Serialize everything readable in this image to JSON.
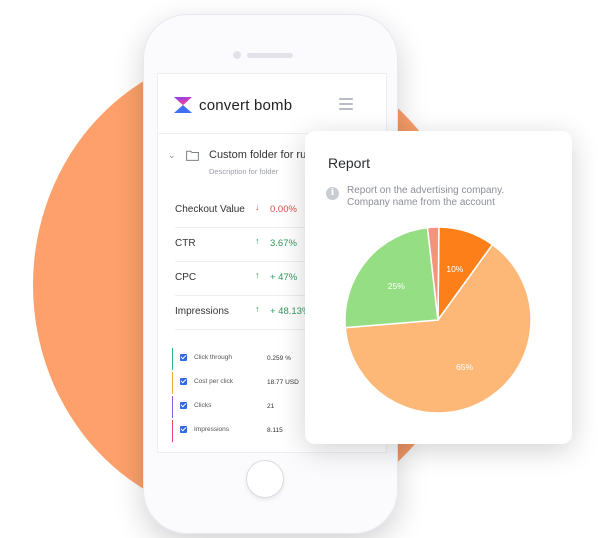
{
  "app": {
    "logo_text": "convert bomb"
  },
  "folder": {
    "title": "Custom folder for rules",
    "description": "Description for folder"
  },
  "metrics": [
    {
      "label": "Checkout Value",
      "direction": "down",
      "value": "0.00%",
      "color": "#e04a4a"
    },
    {
      "label": "CTR",
      "direction": "up",
      "value": "3.67%",
      "color": "#2e9a5e"
    },
    {
      "label": "CPC",
      "direction": "up",
      "value": "+ 47%",
      "color": "#2e9a5e"
    },
    {
      "label": "Impressions",
      "direction": "up",
      "value": "+ 48.13%",
      "color": "#2e9a5e"
    }
  ],
  "mini_table": [
    {
      "name": "Click through",
      "value": "0.259 %",
      "color": "#35b384",
      "checked": true
    },
    {
      "name": "Cost per click",
      "value": "18.77 USD",
      "color": "#f4a640",
      "checked": true
    },
    {
      "name": "Clicks",
      "value": "21",
      "color": "#8a5cd6",
      "checked": true
    },
    {
      "name": "Impressions",
      "value": "8.115",
      "color": "#e0476b",
      "checked": true
    }
  ],
  "report": {
    "title": "Report",
    "description_line1": "Report on the advertising company.",
    "description_line2": "Company name from the account"
  },
  "chart_data": {
    "type": "pie",
    "slices": [
      {
        "value": 65,
        "label": "65%",
        "color": "#fdb777"
      },
      {
        "value": 25,
        "label": "25%",
        "color": "#95de84"
      },
      {
        "value": 2,
        "label": "",
        "color": "#f59380"
      },
      {
        "value": 10,
        "label": "10%",
        "color": "#fd7f1a"
      }
    ]
  },
  "colors": {
    "accent_orange": "#fda06b",
    "brand_purple": "#7b3ff2",
    "brand_pink": "#f23fa0"
  },
  "icons": {
    "menu": "hamburger-icon",
    "folder": "folder-icon",
    "chevron": "chevron-down-icon",
    "info": "info-icon",
    "up": "arrow-up-icon",
    "down": "arrow-down-icon"
  }
}
